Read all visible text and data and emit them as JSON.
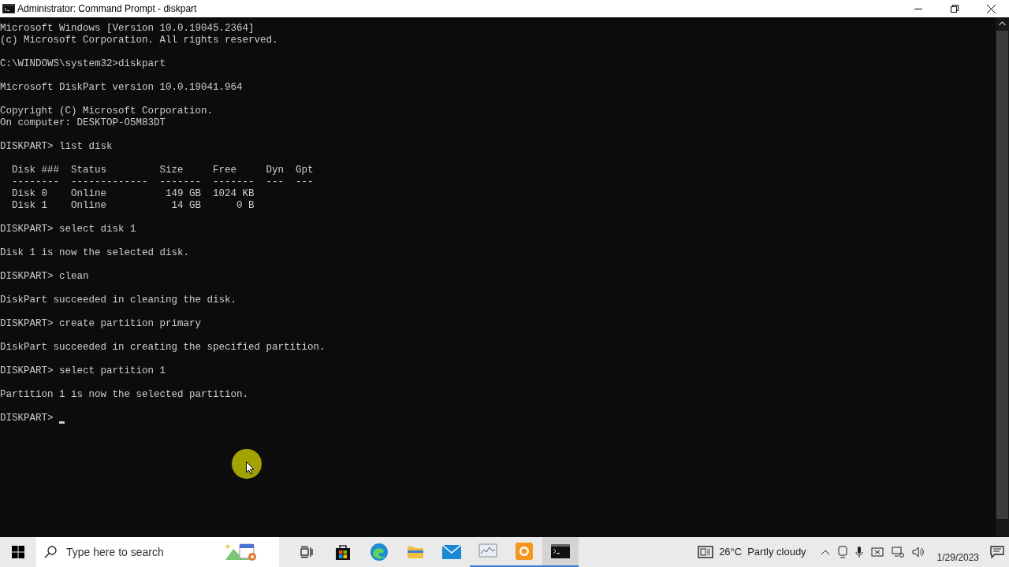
{
  "window": {
    "title": "Administrator: Command Prompt - diskpart"
  },
  "console": {
    "blocks": [
      [
        "Microsoft Windows [Version 10.0.19045.2364]",
        "(c) Microsoft Corporation. All rights reserved."
      ],
      [
        "C:\\WINDOWS\\system32>diskpart"
      ],
      [
        "Microsoft DiskPart version 10.0.19041.964"
      ],
      [
        "Copyright (C) Microsoft Corporation.",
        "On computer: DESKTOP-O5M83DT"
      ],
      [
        "DISKPART> list disk"
      ],
      [
        "  Disk ###  Status         Size     Free     Dyn  Gpt",
        "  --------  -------------  -------  -------  ---  ---",
        "  Disk 0    Online          149 GB  1024 KB",
        "  Disk 1    Online           14 GB      0 B"
      ],
      [
        "DISKPART> select disk 1"
      ],
      [
        "Disk 1 is now the selected disk."
      ],
      [
        "DISKPART> clean"
      ],
      [
        "DiskPart succeeded in cleaning the disk."
      ],
      [
        "DISKPART> create partition primary"
      ],
      [
        "DiskPart succeeded in creating the specified partition."
      ],
      [
        "DISKPART> select partition 1"
      ],
      [
        "Partition 1 is now the selected partition."
      ]
    ],
    "prompt": "DISKPART> "
  },
  "taskbar": {
    "search_placeholder": "Type here to search",
    "weather": {
      "temperature": "26°C",
      "condition": "Partly cloudy"
    },
    "date": "1/29/2023"
  }
}
